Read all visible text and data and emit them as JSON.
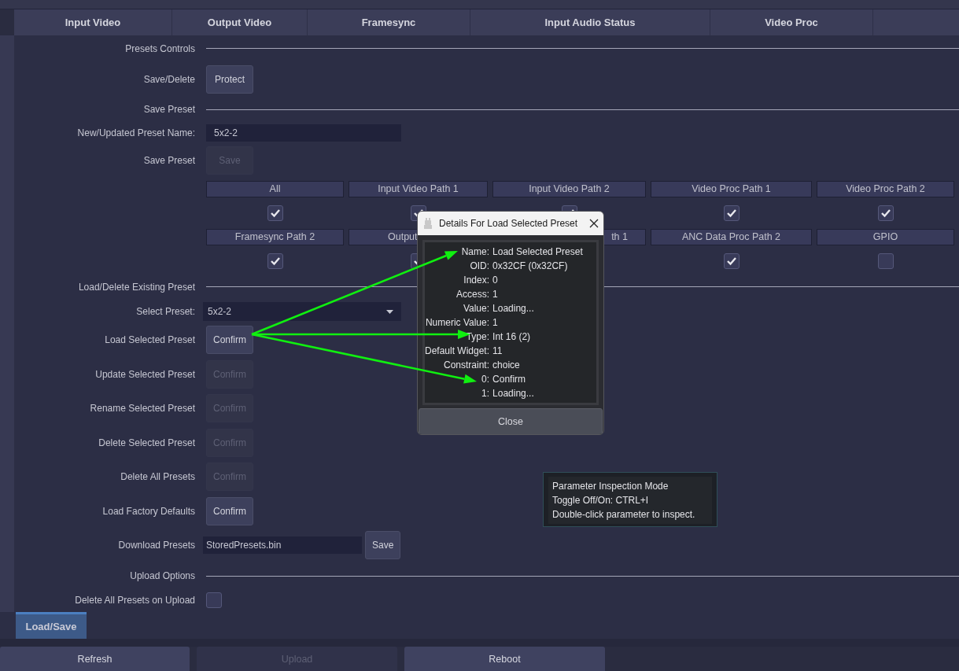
{
  "tabs": [
    {
      "label": "Input Video",
      "selected": false
    },
    {
      "label": "Output Video",
      "selected": false
    },
    {
      "label": "Framesync",
      "selected": false
    },
    {
      "label": "Input Audio Status",
      "selected": false
    },
    {
      "label": "Video Proc",
      "selected": false
    }
  ],
  "rows": [
    {
      "kind": "header",
      "label": "Presets Controls"
    },
    {
      "kind": "button",
      "label": "Save/Delete",
      "button": "Protect",
      "disabled": false
    },
    {
      "kind": "header",
      "label": "Save Preset"
    },
    {
      "kind": "field",
      "label": "New/Updated Preset Name:",
      "value": "5x2-2"
    },
    {
      "kind": "button",
      "label": "Save Preset",
      "button": "Save",
      "disabled": true
    },
    {
      "kind": "grid",
      "cells": [
        {
          "label": "All",
          "kind": "full",
          "checked": true
        },
        {
          "label": "Input Video Path 1",
          "kind": "full",
          "checked": true
        },
        {
          "label": "Input Video Path 2",
          "kind": "full",
          "checked": true
        },
        {
          "label": "Video Proc Path 1",
          "kind": "full",
          "checked": true
        },
        {
          "label": "Video Proc Path 2",
          "kind": "full",
          "checked": true
        },
        {
          "label": "Framesync Path 2",
          "kind": "full",
          "checked": true
        },
        {
          "label": "Output",
          "kind": "start",
          "checked": true
        },
        {
          "label": "th 1",
          "kind": "end"
        },
        {
          "label": "ANC Data Proc Path 2",
          "kind": "full",
          "checked": true
        },
        {
          "label": "GPIO",
          "kind": "full",
          "checked": false
        }
      ]
    },
    {
      "kind": "header",
      "label": "Load/Delete Existing Preset"
    },
    {
      "kind": "select",
      "label": "Select Preset:",
      "value": "5x2-2"
    },
    {
      "kind": "button",
      "label": "Load Selected Preset",
      "button": "Confirm",
      "disabled": false
    },
    {
      "kind": "button",
      "label": "Update Selected Preset",
      "button": "Confirm",
      "disabled": true
    },
    {
      "kind": "button",
      "label": "Rename Selected Preset",
      "button": "Confirm",
      "disabled": true
    },
    {
      "kind": "button",
      "label": "Delete Selected Preset",
      "button": "Confirm",
      "disabled": true
    },
    {
      "kind": "button",
      "label": "Delete All Presets",
      "button": "Confirm",
      "disabled": true
    },
    {
      "kind": "button",
      "label": "Load Factory Defaults",
      "button": "Confirm",
      "disabled": false
    },
    {
      "kind": "field-button",
      "label": "Download Presets",
      "value": "StoredPresets.bin",
      "button": "Save"
    },
    {
      "kind": "header",
      "label": "Upload Options"
    },
    {
      "kind": "checkbox",
      "label": "Delete All Presets on Upload",
      "checked": false
    }
  ],
  "bottom_tab": {
    "label": "Load/Save",
    "selected": true
  },
  "footer_buttons": [
    {
      "label": "Refresh",
      "disabled": false
    },
    {
      "label": "Upload",
      "disabled": true
    },
    {
      "label": "Reboot",
      "disabled": false
    }
  ],
  "dialog": {
    "title": "Details For Load Selected Preset",
    "button": "Close",
    "rows": [
      {
        "key": "Name:",
        "value": "Load Selected Preset"
      },
      {
        "key": "OID:",
        "value": "0x32CF (0x32CF)"
      },
      {
        "key": "Index:",
        "value": "0"
      },
      {
        "key": "Access:",
        "value": "1"
      },
      {
        "key": "Value:",
        "value": "Loading..."
      },
      {
        "key": "Numeric Value:",
        "value": "1"
      },
      {
        "key": "Type:",
        "value": "Int 16 (2)"
      },
      {
        "key": "Default Widget:",
        "value": "11"
      },
      {
        "key": "Constraint:",
        "value": "choice"
      },
      {
        "key": "0:",
        "value": "Confirm"
      },
      {
        "key": "1:",
        "value": "Loading..."
      }
    ]
  },
  "tooltip": {
    "lines": [
      "Parameter Inspection Mode",
      "Toggle Off/On: CTRL+I",
      "Double-click parameter to inspect."
    ]
  }
}
